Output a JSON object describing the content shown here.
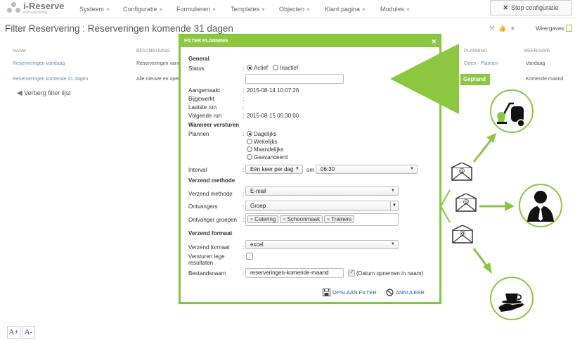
{
  "app": {
    "name": "i-Reserve",
    "tagline": "webreservering"
  },
  "nav": [
    {
      "label": "Systeem"
    },
    {
      "label": "Configuratie"
    },
    {
      "label": "Formulieren"
    },
    {
      "label": "Templates"
    },
    {
      "label": "Objecten"
    },
    {
      "label": "Klant pagina"
    },
    {
      "label": "Modules"
    }
  ],
  "stop_config": "Stop configuratie",
  "page": {
    "title": "Filter Reservering : Reserveringen komende 31 dagen",
    "weergaves": "Weergaves",
    "columns": {
      "naam": "NAAM",
      "beschrijving": "BESCHRIJVING",
      "planning": "PLANNING",
      "weergave": "WEERGAVE"
    },
    "rows": [
      {
        "naam": "Reserveringen vandaag",
        "beschrijving": "Reserveringen vand",
        "planning": "Geen - Plannen",
        "weergave": "Vandaag"
      },
      {
        "naam": "Reserveringen komende 31 dagen",
        "beschrijving": "Alle nieuwe en open",
        "planning": "Gepland",
        "weergave": "Komende maand"
      }
    ],
    "verberg": "Verberg filter lijst",
    "font_up": "A+",
    "font_down": "A-"
  },
  "dialog": {
    "title": "FILTER PLANNING",
    "general": {
      "heading": "General",
      "status_label": "Status",
      "status_options": [
        "Actief",
        "Inactief"
      ],
      "status_selected": "Actief",
      "status_note": "",
      "aangemaakt_label": "Aangemaakt",
      "aangemaakt": "2015-08-14 10:07:26",
      "bijgewerkt_label": "Bijgewerkt",
      "laatste_label": "Laatste run",
      "volgende_label": "Volgende run",
      "volgende": "2015-08-15 05:30:00"
    },
    "wanneer": {
      "heading": "Wanneer versturen",
      "plannen_label": "Plannen",
      "plannen_options": [
        "Dagelijks",
        "Wekelijks",
        "Maandelijks",
        "Geavanceerd"
      ],
      "plannen_selected": "Dagelijks",
      "interval_label": "Interval",
      "interval": "Eén keer per dag",
      "om_label": "om",
      "om": "06:30"
    },
    "methode": {
      "heading": "Verzend methode",
      "methode_label": "Verzend methode",
      "methode": "E-mail",
      "ontvangers_label": "Ontvangers",
      "ontvangers": "Groep",
      "groepen_label": "Ontvanger groepen",
      "groepen": [
        "Catering",
        "Schoonmaak",
        "Trainers"
      ]
    },
    "formaat": {
      "heading": "Verzend formaat",
      "formaat_label": "Verzend formaat",
      "formaat": "excel",
      "lege_label_1": "Versturen lege",
      "lege_label_2": "resultaten",
      "bestand_label": "Bestandsnaam",
      "bestand": "reserveringen-komende-maand",
      "datum_label": "(Datum opnemen in naam)"
    },
    "save_label": "OPSLAAN FILTER",
    "cancel_label": "ANNULEER"
  },
  "colors": {
    "accent": "#8dc63f",
    "link": "#2a5ea8"
  }
}
